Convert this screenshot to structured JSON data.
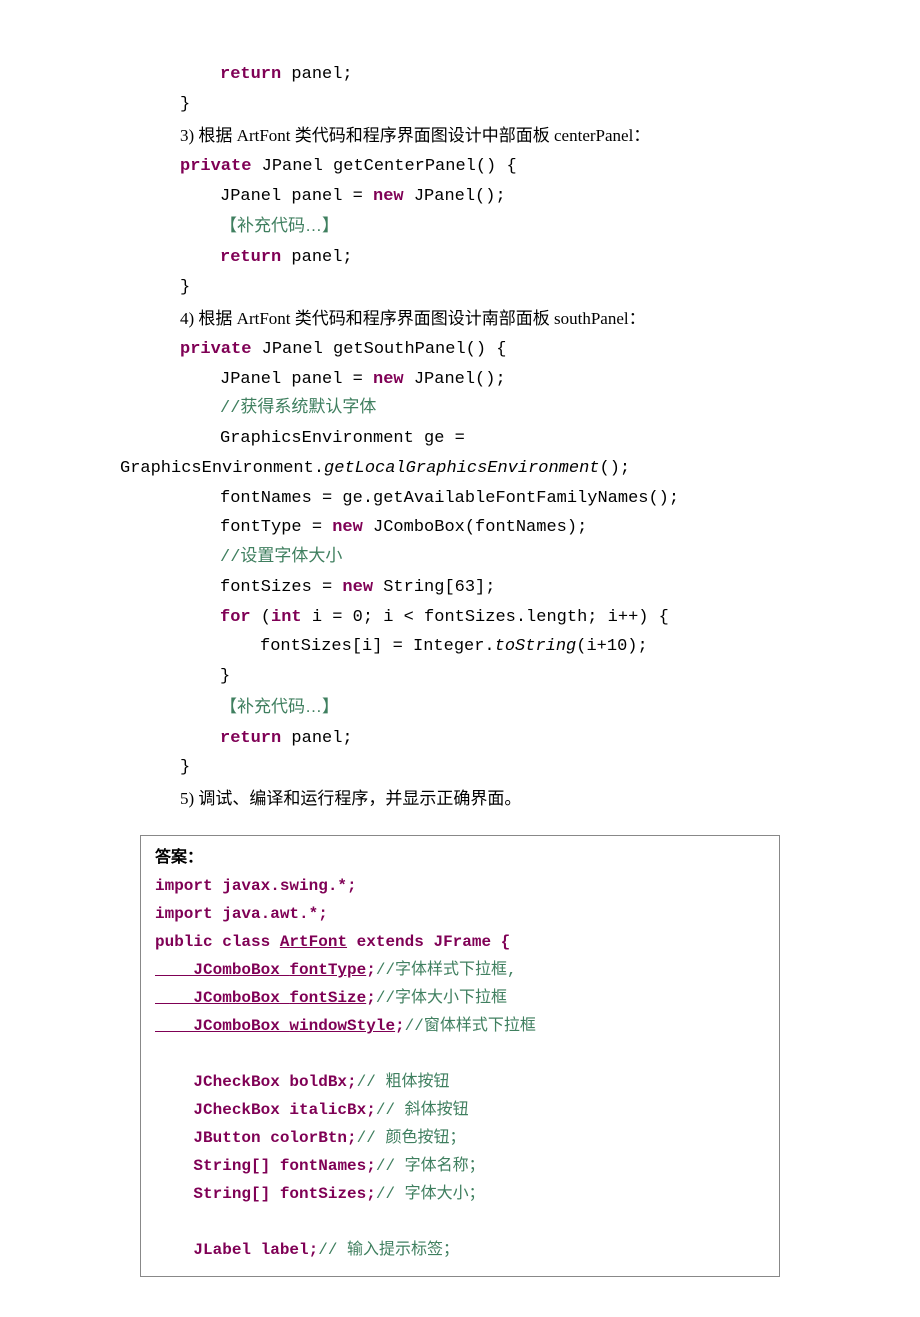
{
  "top": {
    "return_panel": "return",
    "panel_word": " panel;",
    "close_brace": "}",
    "item3_num": "3)",
    "item3_text": "   根据 ArtFont 类代码和程序界面图设计中部面板 centerPanel：",
    "sig3_pre": "private",
    "sig3_post": " JPanel getCenterPanel() {",
    "body3_a": "JPanel panel = ",
    "body3_new": "new",
    "body3_b": " JPanel();",
    "body3_placeholder": "【补充代码…】",
    "body3_return": "return",
    "body3_return_b": " panel;",
    "item4_num": "4)",
    "item4_text": "   根据 ArtFont 类代码和程序界面图设计南部面板 southPanel：",
    "sig4_pre": "private",
    "sig4_post": " JPanel getSouthPanel() {",
    "body4_a": "JPanel panel = ",
    "body4_new": "new",
    "body4_b": " JPanel();",
    "body4_c1": "//获得系统默认字体",
    "body4_ge": "GraphicsEnvironment ge =",
    "body4_ge2_a": "GraphicsEnvironment.",
    "body4_ge2_b": "getLocalGraphicsEnvironment",
    "body4_ge2_c": "();",
    "body4_fn": "fontNames = ge.getAvailableFontFamilyNames();",
    "body4_ft_a": "fontType = ",
    "body4_ft_new": "new",
    "body4_ft_b": " JComboBox(fontNames);",
    "body4_c2": "//设置字体大小",
    "body4_fs_a": "fontSizes = ",
    "body4_fs_new": "new",
    "body4_fs_b": " String[63];",
    "body4_for_kw": "for",
    "body4_for_a": " (",
    "body4_for_int": "int",
    "body4_for_b": " i = 0; i < fontSizes.length; i++) {",
    "body4_for_body_a": "fontSizes[i] = Integer.",
    "body4_for_body_b": "toString",
    "body4_for_body_c": "(i+10);",
    "body4_close": "}",
    "body4_placeholder": "【补充代码…】",
    "body4_return": "return",
    "body4_return_b": " panel;",
    "item5_num": "5)",
    "item5_text": "   调试、编译和运行程序，并显示正确界面。"
  },
  "answer": {
    "label": "答案：",
    "l1_a": "import",
    "l1_b": " javax.swing.*;",
    "blank": "",
    "l2_a": "import",
    "l2_b": " java.awt.*;",
    "l3_a": "public class ",
    "l3_b": "ArtFont",
    "l3_c": " extends",
    "l3_d": " JFrame {",
    "l4_a": "    JComboBox ",
    "l4_b": "fontType",
    "l4_c": ";",
    "l4_d": "//字体样式下拉框,",
    "l5_a": "    JComboBox ",
    "l5_b": "fontSize",
    "l5_c": ";",
    "l5_d": "//字体大小下拉框",
    "l6_a": "    JComboBox ",
    "l6_b": "windowStyle",
    "l6_c": ";",
    "l6_d": "//窗体样式下拉框",
    "l7_a": "    JCheckBox ",
    "l7_b": "boldBx",
    "l7_c": ";",
    "l7_d": "// 粗体按钮",
    "l8_a": "    JCheckBox ",
    "l8_b": "italicBx",
    "l8_c": ";",
    "l8_d": "// 斜体按钮",
    "l9_a": "    JButton ",
    "l9_b": "colorBtn",
    "l9_c": ";",
    "l9_d": "// 颜色按钮；",
    "l10_a": "    String[] ",
    "l10_b": "fontNames",
    "l10_c": ";",
    "l10_d": "// 字体名称；",
    "l11_a": "    String[] ",
    "l11_b": "fontSizes",
    "l11_c": ";",
    "l11_d": "// 字体大小；",
    "l12_a": "    JLabel ",
    "l12_b": "label",
    "l12_c": ";",
    "l12_d": "// 输入提示标签；"
  }
}
